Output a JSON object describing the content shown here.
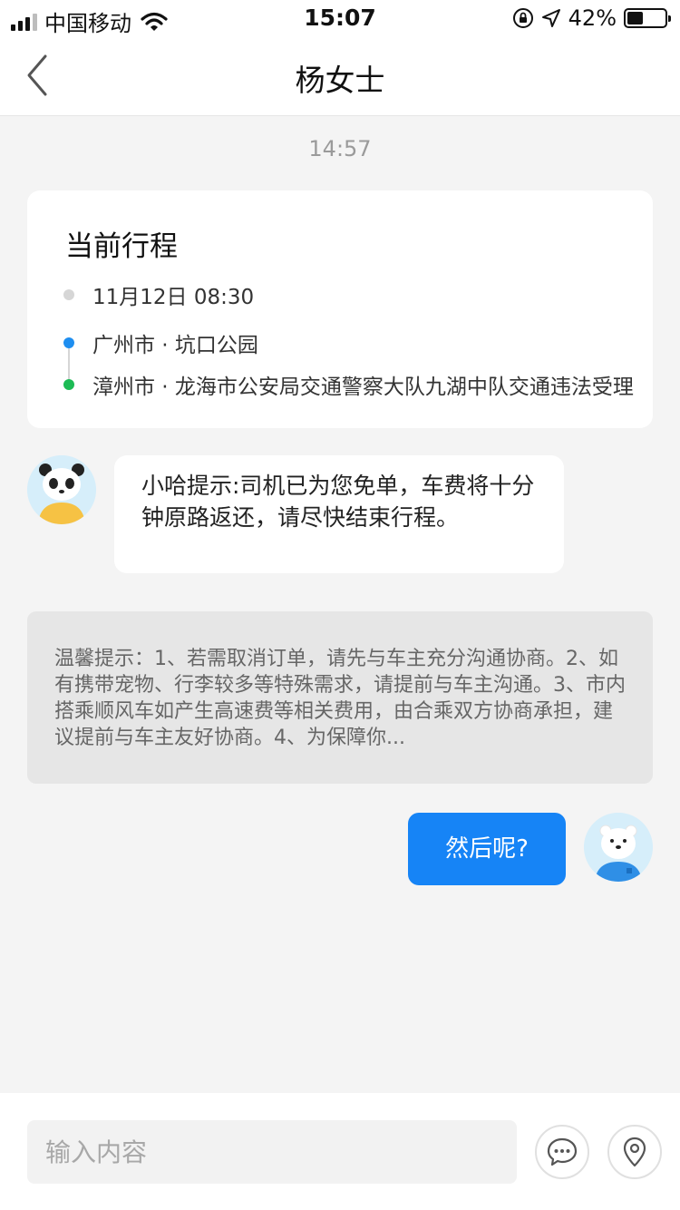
{
  "status_bar": {
    "carrier": "中国移动",
    "time": "15:07",
    "battery_percent": "42%",
    "battery_level": 0.42,
    "icons": [
      "signal-icon",
      "wifi-icon",
      "orientation-lock-icon",
      "location-arrow-icon",
      "battery-icon"
    ]
  },
  "nav": {
    "title": "杨女士",
    "back_icon": "chevron-left-icon"
  },
  "chat": {
    "timestamp": "14:57",
    "trip_card": {
      "title": "当前行程",
      "time": "11月12日 08:30",
      "origin": "广州市 · 坑口公园",
      "destination": "漳州市 · 龙海市公安局交通警察大队九湖中队交通违法受理",
      "colors": {
        "time_dot": "#d6d6d6",
        "origin_dot": "#1e8ef0",
        "destination_dot": "#1dbb55"
      }
    },
    "system_message": "小哈提示:司机已为您免单，车费将十分钟原路返还，请尽快结束行程。",
    "notice": "温馨提示：1、若需取消订单，请先与车主充分沟通协商。2、如有携带宠物、行李较多等特殊需求，请提前与车主沟通。3、市内搭乘顺风车如产生高速费等相关费用，由合乘双方协商承担，建议提前与车主友好协商。4、为保障你...",
    "user_message": "然后呢?",
    "avatars": {
      "left": "panda-avatar",
      "right": "polar-bear-avatar"
    }
  },
  "input_bar": {
    "placeholder": "输入内容",
    "icons": [
      "quick-reply-icon",
      "location-pin-icon"
    ]
  },
  "colors": {
    "accent": "#1684f6",
    "background": "#f4f4f4",
    "notice_bg": "#e6e6e6"
  }
}
